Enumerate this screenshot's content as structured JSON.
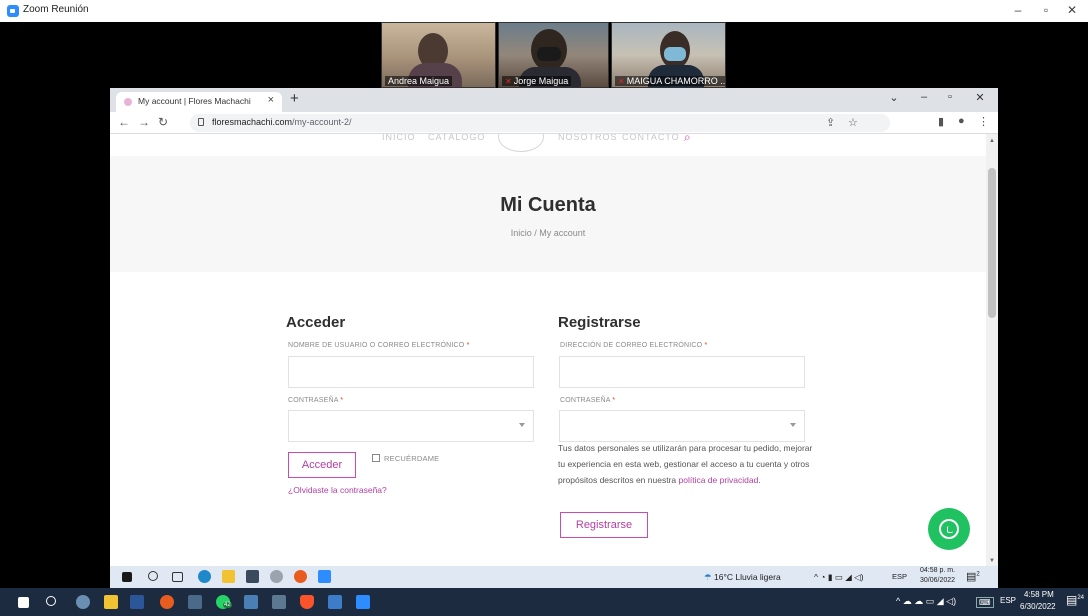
{
  "zoom": {
    "window_title": "Zoom Reunión",
    "controls": {
      "minimize": "–",
      "restore": "▫",
      "close": "✕"
    },
    "participants": [
      {
        "name": "Andrea Maigua",
        "muted": false
      },
      {
        "name": "Jorge Maigua",
        "muted": true
      },
      {
        "name": "MAIGUA CHAMORRO ...",
        "muted": true
      }
    ]
  },
  "browser": {
    "tab_title": "My account | Flores Machachi",
    "tab_close": "×",
    "new_tab": "+",
    "controls": {
      "tabsearch": "⌄",
      "minimize": "–",
      "restore": "▫",
      "close": "✕"
    },
    "nav": {
      "back": "←",
      "forward": "→",
      "reload": "↻"
    },
    "url_domain": "floresmachachi.com",
    "url_path": "/my-account-2/",
    "toolbar_icons": {
      "share": "⇪",
      "star": "☆",
      "sidepanel": "▮",
      "profile": "●",
      "menu": "⋮"
    }
  },
  "page": {
    "nav_items": [
      "INICIO",
      "CATÁLOGO",
      "NOSOTROS",
      "CONTACTO"
    ],
    "search_glyph": "⌕",
    "hero_title": "Mi Cuenta",
    "breadcrumb": "Inicio / My account",
    "login": {
      "heading": "Acceder",
      "username_label": "NOMBRE DE USUARIO O CORREO ELECTRÓNICO",
      "password_label": "CONTRASEÑA",
      "required_mark": "*",
      "submit": "Acceder",
      "remember": "RECUÉRDAME",
      "forgot": "¿Olvidaste la contraseña?"
    },
    "register": {
      "heading": "Registrarse",
      "email_label": "DIRECCIÓN DE CORREO ELECTRÓNICO",
      "password_label": "CONTRASEÑA",
      "privacy_text": "Tus datos personales se utilizarán para procesar tu pedido, mejorar tu experiencia en esta web, gestionar el acceso a tu cuenta y otros propósitos descritos en nuestra ",
      "privacy_link": "política de privacidad",
      "privacy_end": ".",
      "submit": "Registrarse"
    }
  },
  "remote_taskbar": {
    "weather": "16°C  Lluvia ligera",
    "lang": "ESP",
    "time": "04:58 p. m.",
    "date": "30/06/2022",
    "notif_count": "2"
  },
  "local_taskbar": {
    "lang": "ESP",
    "time": "4:58 PM",
    "date": "6/30/2022",
    "notif_count": "24",
    "badge": "42"
  },
  "colors": {
    "accent": "#b13fa1",
    "required": "#e2401c",
    "whatsapp": "#1fc160",
    "local_taskbar": "#1c2b3f",
    "remote_taskbar": "#dfe8f3"
  }
}
